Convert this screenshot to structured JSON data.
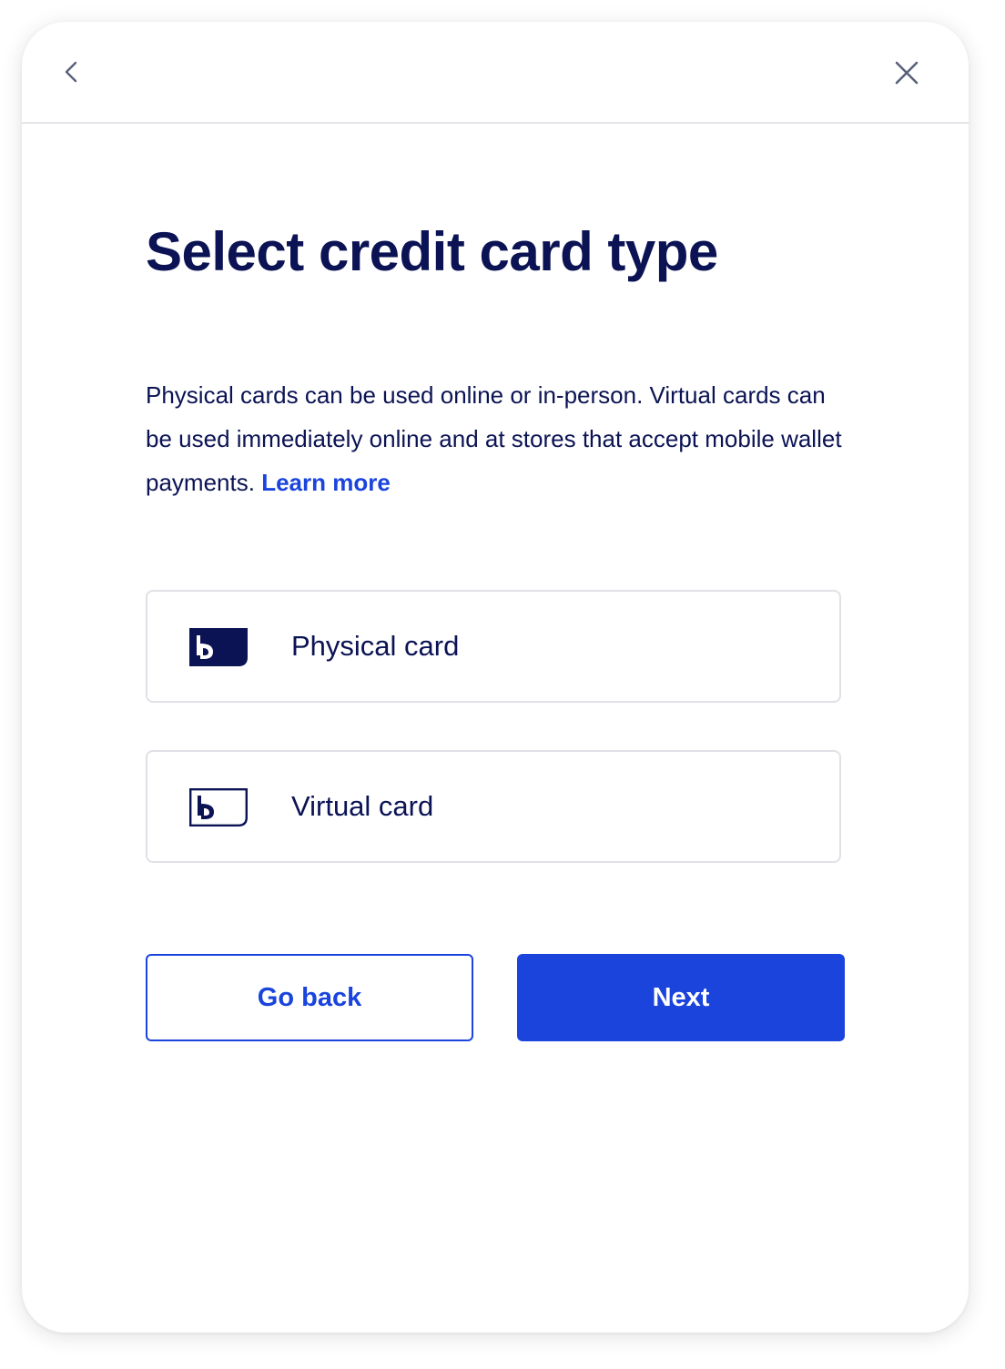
{
  "modal": {
    "back_icon": "chevron-left-icon",
    "close_icon": "close-icon"
  },
  "title": "Select credit card type",
  "description": {
    "text": "Physical cards can be used online or in-person. Virtual cards can be used immediately online and at stores that accept mobile wallet payments.",
    "link_label": "Learn more"
  },
  "options": [
    {
      "label": "Physical card",
      "icon": "physical-card-icon"
    },
    {
      "label": "Virtual card",
      "icon": "virtual-card-icon"
    }
  ],
  "buttons": {
    "secondary_label": "Go back",
    "primary_label": "Next"
  },
  "colors": {
    "brand_navy": "#0b1354",
    "accent_blue": "#1b44dd",
    "border_gray": "#dfe1e6"
  }
}
